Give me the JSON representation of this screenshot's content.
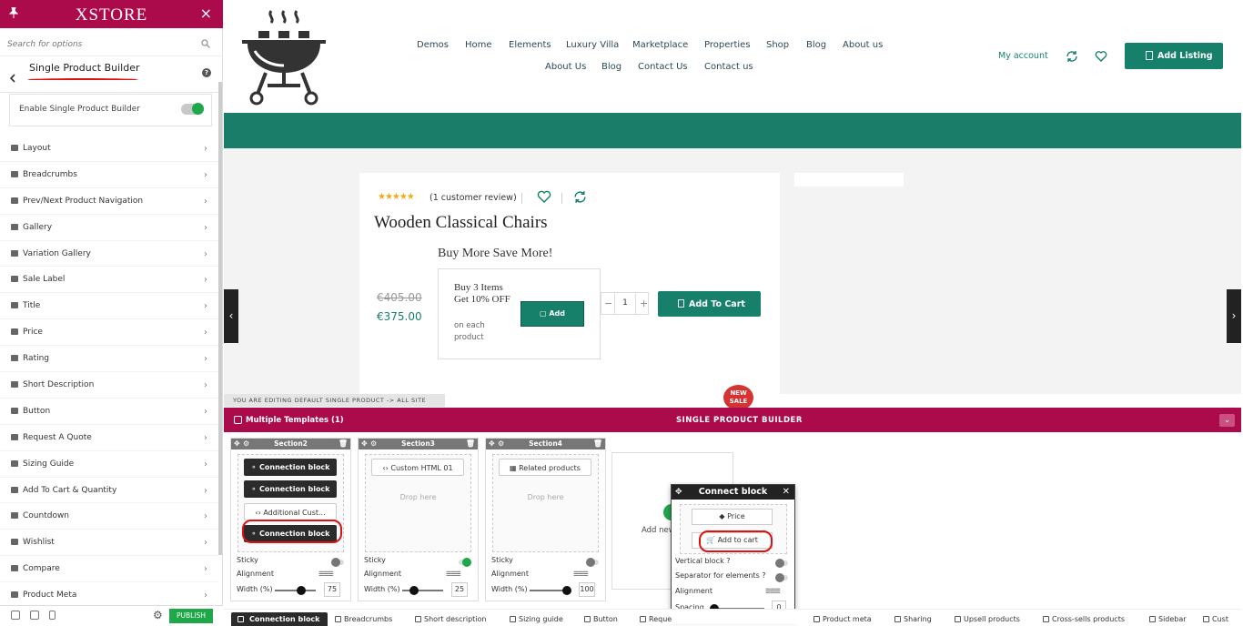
{
  "sidebar": {
    "logo": "XSTORE",
    "search_placeholder": "Search for options",
    "section_title": "Single Product Builder",
    "enable_label": "Enable Single Product Builder",
    "items": [
      {
        "label": "Layout",
        "icon": "layout-icon"
      },
      {
        "label": "Breadcrumbs",
        "icon": "breadcrumbs-icon"
      },
      {
        "label": "Prev/Next Product Navigation",
        "icon": "navigation-icon"
      },
      {
        "label": "Gallery",
        "icon": "gallery-icon"
      },
      {
        "label": "Variation Gallery",
        "icon": "variation-gallery-icon"
      },
      {
        "label": "Sale Label",
        "icon": "sale-label-icon"
      },
      {
        "label": "Title",
        "icon": "title-icon"
      },
      {
        "label": "Price",
        "icon": "price-icon"
      },
      {
        "label": "Rating",
        "icon": "star-icon"
      },
      {
        "label": "Short Description",
        "icon": "description-icon"
      },
      {
        "label": "Button",
        "icon": "button-icon"
      },
      {
        "label": "Request A Quote",
        "icon": "quote-icon"
      },
      {
        "label": "Sizing Guide",
        "icon": "sizing-guide-icon"
      },
      {
        "label": "Add To Cart & Quantity",
        "icon": "cart-icon"
      },
      {
        "label": "Countdown",
        "icon": "hourglass-icon"
      },
      {
        "label": "Wishlist",
        "icon": "heart-icon"
      },
      {
        "label": "Compare",
        "icon": "compare-icon"
      },
      {
        "label": "Product Meta",
        "icon": "meta-icon"
      }
    ],
    "publish_label": "PUBLISH"
  },
  "header": {
    "nav_row1": [
      "Demos",
      "Home",
      "Elements",
      "Luxury Villa",
      "Marketplace",
      "Properties",
      "Shop",
      "Blog",
      "About us"
    ],
    "nav_row2": [
      "About Us",
      "Blog",
      "Contact Us",
      "Contact us"
    ],
    "my_account": "My account",
    "add_listing": "Add Listing"
  },
  "product": {
    "review_text": "(1 customer review)",
    "rating": 5,
    "title": "Wooden Classical Chairs",
    "promo_heading": "Buy More Save More!",
    "old_price": "€405.00",
    "new_price": "€375.00",
    "offer_title": "Buy 3 Items Get 10% OFF",
    "offer_sub": "on each product",
    "offer_button": "Add",
    "quantity": "1",
    "add_to_cart": "Add To Cart"
  },
  "editing_notice": "YOU ARE EDITING DEFAULT SINGLE PRODUCT -> ALL SITE",
  "badge": {
    "line1": "NEW",
    "line2": "SALE"
  },
  "builder": {
    "templates_label": "Multiple Templates (1)",
    "title": "SINGLE PRODUCT BUILDER",
    "sections": [
      {
        "name": "Section2",
        "blocks": [
          "Connection block",
          "Connection block",
          "Additional Cust...",
          "Connection block"
        ],
        "sticky_label": "Sticky",
        "alignment_label": "Alignment",
        "width_label": "Width (%)",
        "width": "75"
      },
      {
        "name": "Section3",
        "blocks": [
          "Custom HTML 01"
        ],
        "drop_here": "Drop here",
        "sticky_label": "Sticky",
        "alignment_label": "Alignment",
        "width_label": "Width (%)",
        "width": "25"
      },
      {
        "name": "Section4",
        "blocks": [
          "Related products"
        ],
        "drop_here": "Drop here",
        "sticky_label": "Sticky",
        "alignment_label": "Alignment",
        "width_label": "Width (%)",
        "width": "100"
      }
    ],
    "add_new": "Add new",
    "popup": {
      "title": "Connect block",
      "blocks": [
        "Price",
        "Add to cart"
      ],
      "vertical_label": "Vertical block ?",
      "separator_label": "Separator for elements ?",
      "alignment_label": "Alignment",
      "spacing_label": "Spacing",
      "spacing_value": "0"
    },
    "tabs": [
      "Connection block",
      "Breadcrumbs",
      "Short description",
      "Sizing guide",
      "Button",
      "Reque",
      "Product meta",
      "Sharing",
      "Upsell products",
      "Cross-sells products",
      "Sidebar",
      "Cust"
    ]
  },
  "colors": {
    "accent": "#ab0a4b",
    "brand_green": "#17806a",
    "toggle_green": "#1ea84a",
    "annotation_red": "#dd1111"
  }
}
